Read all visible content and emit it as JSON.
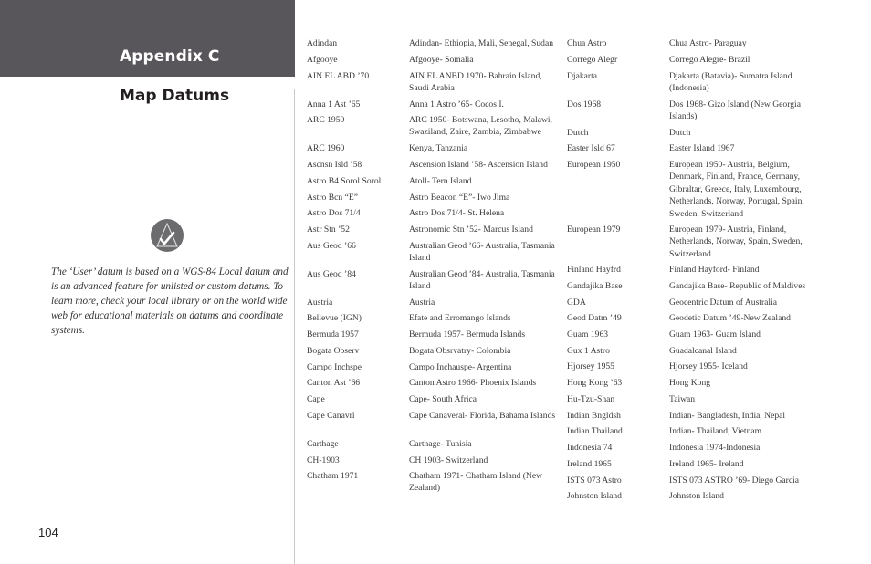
{
  "header": {
    "section": "Appendix C",
    "title": "Map Datums"
  },
  "note": {
    "icon": "checkmark-triangle-icon",
    "text": "The ‘User’ datum is based on a WGS-84 Local datum and is an advanced feature for unlisted or custom datums. To learn more, check your local library or on the world wide web for educational materials on datums and coordinate systems."
  },
  "page_number": "104",
  "datums_left": [
    {
      "abbr": "Adindan",
      "full": "Adindan- Ethiopia, Mali, Senegal, Sudan"
    },
    {
      "abbr": "Afgooye",
      "full": "Afgooye- Somalia"
    },
    {
      "abbr": "AIN EL ABD ’70",
      "full": "AIN EL ANBD 1970- Bahrain Island, Saudi Arabia"
    },
    {
      "abbr": "Anna 1 Ast ’65",
      "full": "Anna 1 Astro ’65- Cocos I."
    },
    {
      "abbr": "ARC 1950",
      "full": "ARC 1950- Botswana, Lesotho, Malawi, Swaziland, Zaire, Zambia, Zimbabwe"
    },
    {
      "abbr": "ARC 1960",
      "full": "Kenya, Tanzania"
    },
    {
      "abbr": "Ascnsn Isld ’58",
      "full": "Ascension Island ’58- Ascension Island"
    },
    {
      "abbr": "Astro B4 Sorol Sorol",
      "full": "Atoll- Tern Island"
    },
    {
      "abbr": "Astro Bcn “E”",
      "full": "Astro Beacon “E”- Iwo Jima"
    },
    {
      "abbr": "Astro Dos 71/4",
      "full": "Astro Dos 71/4- St. Helena"
    },
    {
      "abbr": "Astr Stn ’52",
      "full": "Astronomic Stn ’52- Marcus Island"
    },
    {
      "abbr": "Aus Geod ’66",
      "full": "Australian Geod ’66- Australia, Tasmania Island"
    },
    {
      "abbr": "Aus Geod ’84",
      "full": "Australian Geod ’84- Australia, Tasmania Island"
    },
    {
      "abbr": "Austria",
      "full": "Austria"
    },
    {
      "abbr": "Bellevue (IGN)",
      "full": "Efate and Erromango Islands"
    },
    {
      "abbr": "Bermuda 1957",
      "full": "Bermuda 1957- Bermuda Islands"
    },
    {
      "abbr": "Bogata Observ",
      "full": "Bogata Obsrvatry- Colombia"
    },
    {
      "abbr": "Campo Inchspe",
      "full": "Campo Inchauspe- Argentina"
    },
    {
      "abbr": "Canton Ast ’66",
      "full": "Canton Astro 1966- Phoenix Islands"
    },
    {
      "abbr": "Cape",
      "full": "Cape- South Africa"
    },
    {
      "abbr": "Cape Canavrl",
      "full": "Cape Canaveral- Florida, Bahama Islands"
    },
    {
      "abbr": "Carthage",
      "full": "Carthage- Tunisia"
    },
    {
      "abbr": "CH-1903",
      "full": "CH 1903- Switzerland"
    },
    {
      "abbr": "Chatham 1971",
      "full": "Chatham 1971- Chatham Island (New Zealand)"
    }
  ],
  "datums_right": [
    {
      "abbr": "Chua Astro",
      "full": "Chua Astro- Paraguay"
    },
    {
      "abbr": "Corrego Alegr",
      "full": "Corrego Alegre- Brazil"
    },
    {
      "abbr": "Djakarta",
      "full": "Djakarta (Batavia)- Sumatra Island (Indonesia)"
    },
    {
      "abbr": "Dos 1968",
      "full": "Dos 1968- Gizo Island (New Georgia Islands)"
    },
    {
      "abbr": "Dutch",
      "full": "Dutch"
    },
    {
      "abbr": "Easter Isld 67",
      "full": "Easter Island 1967"
    },
    {
      "abbr": "European 1950",
      "full": "European 1950- Austria, Belgium, Denmark, Finland, France, Germany, Gibraltar, Greece, Italy, Luxembourg, Netherlands, Norway, Portugal, Spain, Sweden, Switzerland"
    },
    {
      "abbr": "European 1979",
      "full": "European 1979- Austria, Finland, Netherlands, Norway, Spain, Sweden, Switzerland"
    },
    {
      "abbr": "Finland Hayfrd",
      "full": "Finland Hayford- Finland"
    },
    {
      "abbr": "Gandajika Base",
      "full": "Gandajika Base- Republic of Maldives"
    },
    {
      "abbr": "GDA",
      "full": "Geocentric Datum of Australia"
    },
    {
      "abbr": "Geod Datm ’49",
      "full": "Geodetic Datum ’49-New Zealand"
    },
    {
      "abbr": "Guam 1963",
      "full": "Guam 1963- Guam Island"
    },
    {
      "abbr": "Gux 1 Astro",
      "full": "Guadalcanal Island"
    },
    {
      "abbr": "Hjorsey 1955",
      "full": "Hjorsey 1955- Iceland"
    },
    {
      "abbr": "Hong Kong ’63",
      "full": "Hong Kong"
    },
    {
      "abbr": "Hu-Tzu-Shan",
      "full": "Taiwan"
    },
    {
      "abbr": "Indian Bngldsh",
      "full": "Indian- Bangladesh, India, Nepal"
    },
    {
      "abbr": "Indian Thailand",
      "full": "Indian- Thailand, Vietnam"
    },
    {
      "abbr": "Indonesia 74",
      "full": "Indonesia 1974-Indonesia"
    },
    {
      "abbr": "Ireland 1965",
      "full": "Ireland 1965- Ireland"
    },
    {
      "abbr": "ISTS 073 Astro",
      "full": "ISTS 073 ASTRO ’69- Diego Garcia"
    },
    {
      "abbr": "Johnston Island",
      "full": "Johnston Island"
    }
  ]
}
